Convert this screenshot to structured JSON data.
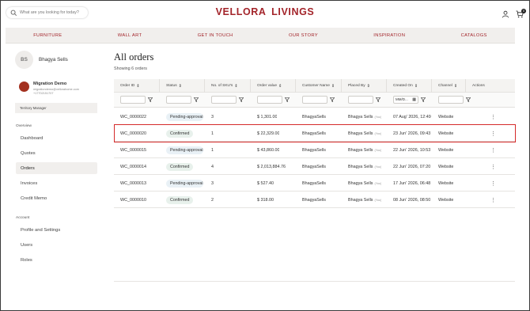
{
  "header": {
    "search_placeholder": "What are you looking for today?",
    "logo": "VELLORA  LIVINGS",
    "cart_count": "0"
  },
  "nav": [
    "FURNITURE",
    "WALL ART",
    "GET IN TOUCH",
    "OUR STORY",
    "INSPIRATION",
    "CATALOGS"
  ],
  "sidebar": {
    "avatar_initials": "BS",
    "user_name": "Bhagya Sells",
    "org": {
      "name": "Migration Demo",
      "email": "migrationdemo@vellorahome.com",
      "phone": "+17702151707",
      "role": "Territory Manager"
    },
    "overview_label": "Overview",
    "overview_items": [
      "Dashboard",
      "Quotes",
      "Orders",
      "Invoices",
      "Credit Memo"
    ],
    "account_label": "Account",
    "account_items": [
      "Profile and Settings",
      "Users",
      "Roles"
    ]
  },
  "main": {
    "title": "All orders",
    "count_text": "Showing 6 orders",
    "columns": [
      "Order ID",
      "Status",
      "No. of SKU's",
      "Order value",
      "Customer Name",
      "Placed By",
      "Created On",
      "Channel",
      "Actions"
    ],
    "date_placeholder": "MM/D...",
    "you_label": "(You)",
    "rows": [
      {
        "id": "WC_0000022",
        "status": "Pending-approval",
        "status_type": "pending",
        "skus": "3",
        "value": "$ 1,301.00",
        "customer": "BhagyaSells",
        "placed_by": "Bhagya Sells",
        "created": "07 Aug' 2026, 12:49",
        "channel": "Website"
      },
      {
        "id": "WC_0000020",
        "status": "Confirmed",
        "status_type": "confirmed",
        "skus": "1",
        "value": "$ 22,329.00",
        "customer": "BhagyaSells",
        "placed_by": "Bhagya Sells",
        "created": "23 Jun' 2026, 09:43",
        "channel": "Website"
      },
      {
        "id": "WC_0000015",
        "status": "Pending-approval",
        "status_type": "pending",
        "skus": "1",
        "value": "$ 43,860.00",
        "customer": "BhagyaSells",
        "placed_by": "Bhagya Sells",
        "created": "22 Jun' 2026, 10:53",
        "channel": "Website"
      },
      {
        "id": "WC_0000014",
        "status": "Confirmed",
        "status_type": "confirmed",
        "skus": "4",
        "value": "$ 2,013,884.76",
        "customer": "BhagyaSells",
        "placed_by": "Bhagya Sells",
        "created": "22 Jun' 2026, 07:20",
        "channel": "Website"
      },
      {
        "id": "WC_0000013",
        "status": "Pending-approval",
        "status_type": "pending",
        "skus": "3",
        "value": "$ 527.40",
        "customer": "BhagyaSells",
        "placed_by": "Bhagya Sells",
        "created": "17 Jun' 2026, 06:48",
        "channel": "Website"
      },
      {
        "id": "WC_0000010",
        "status": "Confirmed",
        "status_type": "confirmed",
        "skus": "2",
        "value": "$ 318.00",
        "customer": "BhagyaSells",
        "placed_by": "Bhagya Sells",
        "created": "08 Jun' 2026, 08:50",
        "channel": "Website"
      }
    ]
  }
}
